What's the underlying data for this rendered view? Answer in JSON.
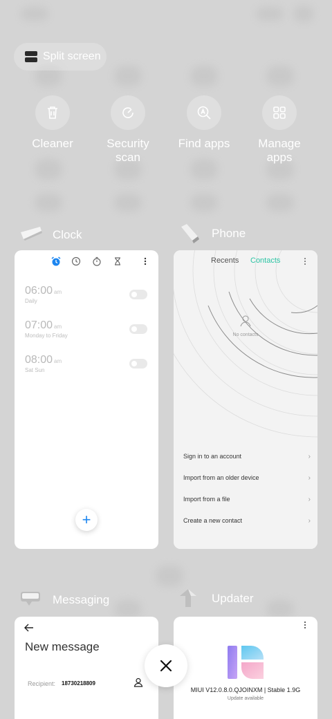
{
  "split_screen": {
    "label": "Split screen",
    "icon": "split-screen-icon"
  },
  "quick_actions": [
    {
      "label": "Cleaner",
      "icon": "trash-icon"
    },
    {
      "label": "Security\nscan",
      "icon": "security-scan-icon"
    },
    {
      "label": "Find apps",
      "icon": "find-apps-icon"
    },
    {
      "label": "Manage\napps",
      "icon": "grid-icon"
    }
  ],
  "apps": {
    "clock": {
      "name": "Clock",
      "tabs": [
        "alarm-icon",
        "clock-icon",
        "stopwatch-icon",
        "timer-icon",
        "more-icon"
      ],
      "alarms": [
        {
          "time": "06:00",
          "ampm": "am",
          "days": "Daily"
        },
        {
          "time": "07:00",
          "ampm": "am",
          "days": "Monday to Friday"
        },
        {
          "time": "08:00",
          "ampm": "am",
          "days": "Sat Sun"
        }
      ],
      "fab": "+"
    },
    "phone": {
      "name": "Phone",
      "tabs": [
        "Recents",
        "Contacts"
      ],
      "no_contacts": "No contacts",
      "options": [
        "Sign in to an account",
        "Import from an older device",
        "Import from a file",
        "Create a new contact"
      ],
      "chevron": "›"
    },
    "messaging": {
      "name": "Messaging",
      "title": "New message",
      "recipient_label": "Recipient:",
      "recipient_value": "18730218809"
    },
    "updater": {
      "name": "Updater",
      "version": "MIUI V12.0.8.0.QJOINXM | Stable 1.9G",
      "status": "Update available"
    }
  },
  "colors": {
    "accent_blue": "#1d86f0",
    "contacts_green": "#2bc4a4"
  },
  "close_button": {
    "icon": "close-icon"
  }
}
